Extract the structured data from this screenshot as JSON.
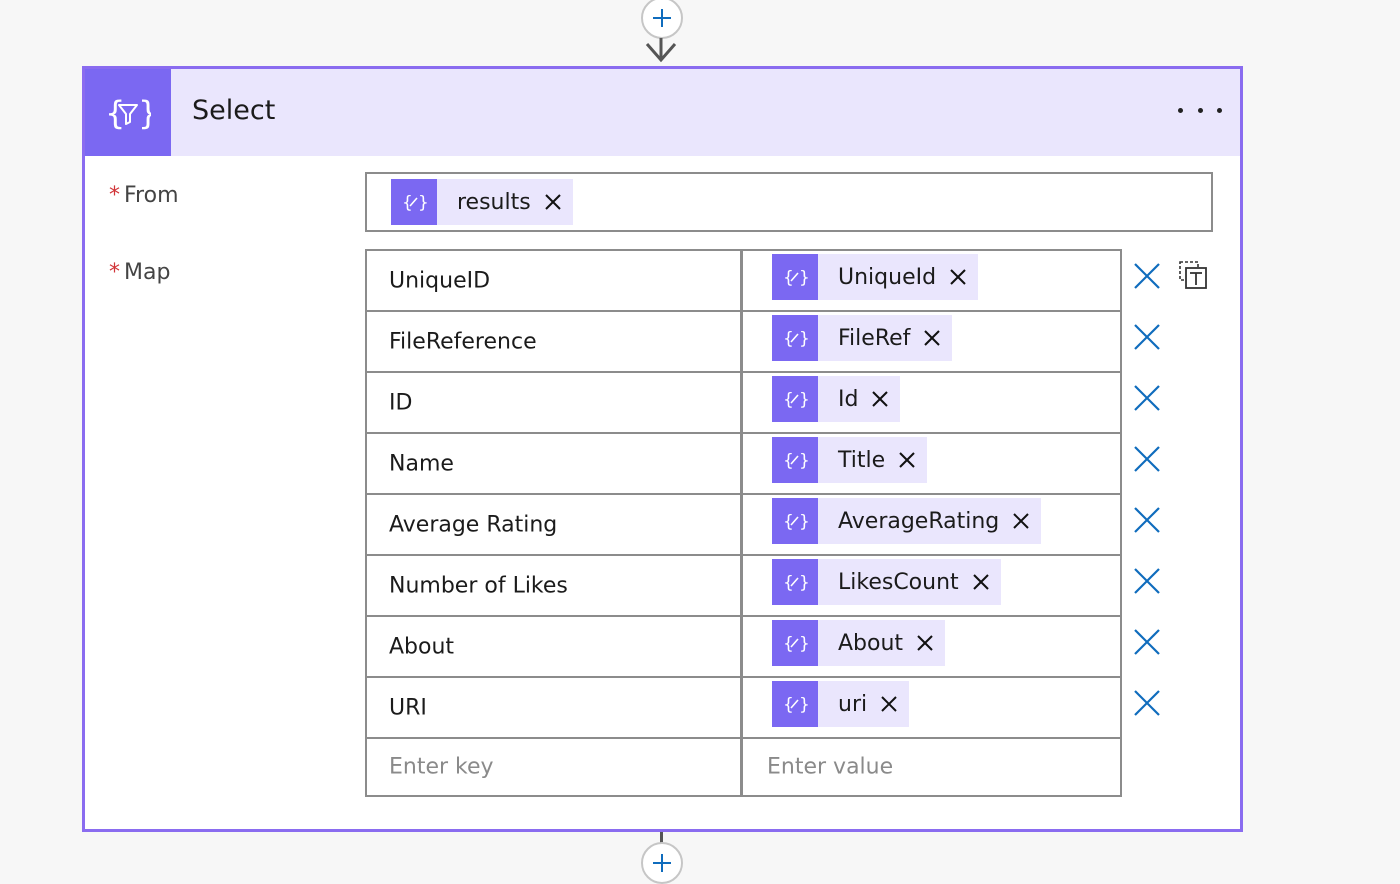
{
  "action": {
    "title": "Select",
    "icon": "data-operation-icon",
    "menu_icon": "more-options-icon"
  },
  "from": {
    "label": "From",
    "required_mark": "*",
    "token": {
      "label": "results",
      "icon": "expression-token-icon"
    }
  },
  "map": {
    "label": "Map",
    "required_mark": "*",
    "rows": [
      {
        "key": "UniqueID",
        "value": "UniqueId"
      },
      {
        "key": "FileReference",
        "value": "FileRef"
      },
      {
        "key": "ID",
        "value": "Id"
      },
      {
        "key": "Name",
        "value": "Title"
      },
      {
        "key": "Average Rating",
        "value": "AverageRating"
      },
      {
        "key": "Number of Likes",
        "value": "LikesCount"
      },
      {
        "key": "About",
        "value": "About"
      },
      {
        "key": " URI",
        "value": "uri"
      }
    ],
    "key_placeholder": "Enter key",
    "value_placeholder": "Enter value"
  },
  "colors": {
    "accent": "#7b68f2",
    "header_bg": "#eae6fd",
    "card_border": "#8a6cf0",
    "delete_icon": "#0f6cbd",
    "required": "#d13438"
  }
}
